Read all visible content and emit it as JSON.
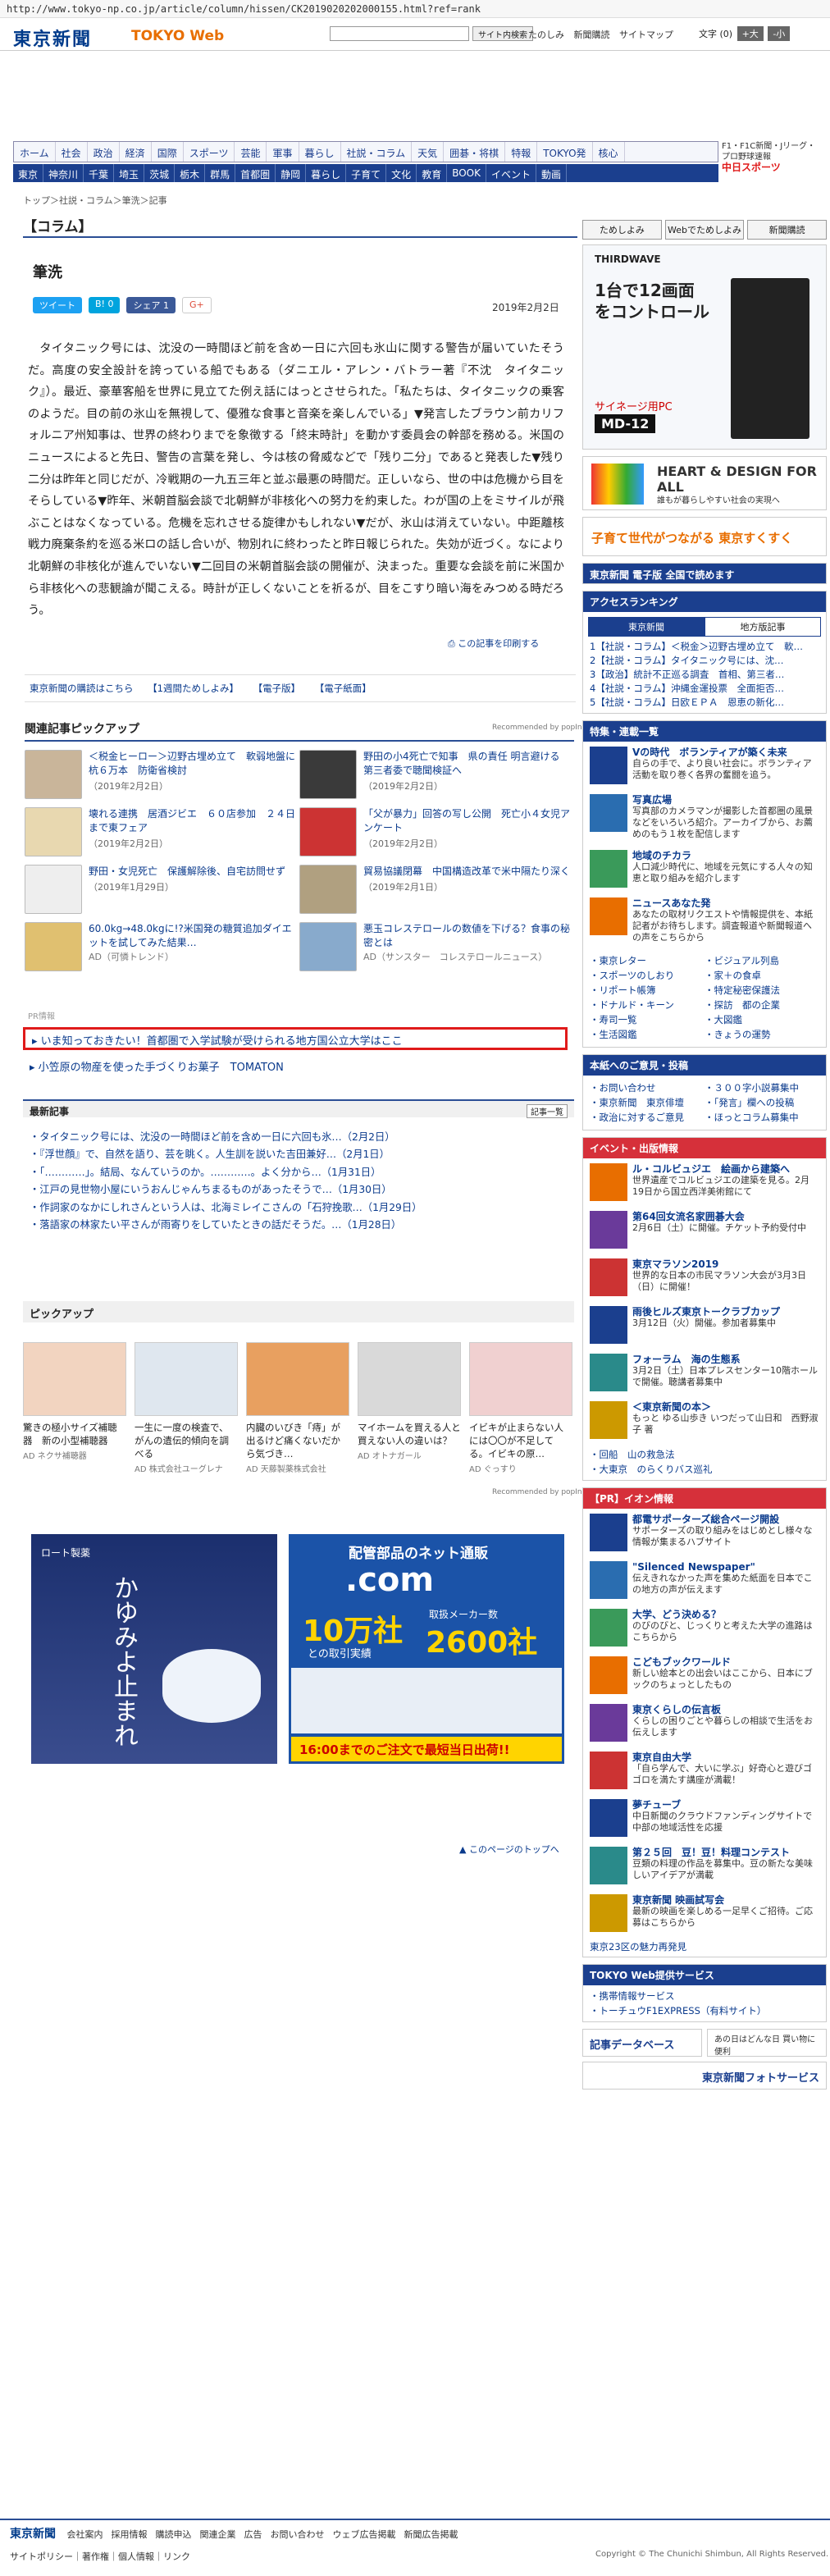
{
  "url": "http://www.tokyo-np.co.jp/article/column/hissen/CK2019020202000155.html?ref=rank",
  "brand": {
    "main": "東京新聞",
    "web": "TOKYO Web"
  },
  "topbar": {
    "search_btn": "サイト内検索",
    "links": [
      "たのしみ",
      "新聞購読",
      "サイトマップ"
    ],
    "font": "文字",
    "font_size": "(0)",
    "plus": "+大",
    "minus": "-小"
  },
  "nav1": [
    "ホーム",
    "社会",
    "政治",
    "経済",
    "国際",
    "スポーツ",
    "芸能",
    "軍事",
    "暮らし",
    "社説・コラム",
    "天気",
    "囲碁・将棋",
    "特報",
    "TOKYO発",
    "核心"
  ],
  "nav2": [
    "東京",
    "神奈川",
    "千葉",
    "埼玉",
    "茨城",
    "栃木",
    "群馬",
    "首都圏",
    "静岡",
    "暮らし",
    "子育て",
    "文化",
    "教育",
    "BOOK",
    "イベント",
    "動画"
  ],
  "chunichi": {
    "line1": "F1・F1C新聞・Jリーグ・プロ野球速報",
    "brand": "中日スポーツ"
  },
  "breadcrumb": "トップ＞社説・コラム＞筆洗＞記事",
  "column_head": "【コラム】",
  "article": {
    "title": "筆洗",
    "date": "2019年2月2日",
    "share": [
      "ツイート",
      "B! 0",
      "シェア 1",
      "G+"
    ],
    "body": "タイタニック号には、沈没の一時間ほど前を含め一日に六回も氷山に関する警告が届いていたそうだ。高度の安全設計を誇っている船でもある（ダニエル・アレン・バトラー著『不沈　タイタニック』）。最近、豪華客船を世界に見立てた例え話にはっとさせられた。「私たちは、タイタニックの乗客のようだ。目の前の氷山を無視して、優雅な食事と音楽を楽しんでいる」▼発言したブラウン前カリフォルニア州知事は、世界の終わりまでを象徴する「終末時計」を動かす委員会の幹部を務める。米国のニュースによると先日、警告の言葉を発し、今は核の脅威などで「残り二分」であると発表した▼残り二分は昨年と同じだが、冷戦期の一九五三年と並ぶ最悪の時間だ。正しいなら、世の中は危機から目をそらしている▼昨年、米朝首脳会談で北朝鮮が非核化への努力を約束した。わが国の上をミサイルが飛ぶことはなくなっている。危機を忘れさせる旋律かもしれない▼だが、氷山は消えていない。中距離核戦力廃棄条約を巡る米ロの話し合いが、物別れに終わったと昨日報じられた。失効が近づく。なにより北朝鮮の非核化が進んでいない▼二回目の米朝首脳会談の開催が、決まった。重要な会談を前に米国から非核化への悲観論が聞こえる。時計が正しくないことを祈るが、目をこすり暗い海をみつめる時だろう。",
    "print": "この記事を印刷する",
    "links": [
      "東京新聞の購読はこちら",
      "【1週間ためしよみ】",
      "【電子版】",
      "【電子紙面】"
    ]
  },
  "related": {
    "title": "関連記事ピックアップ",
    "recommended": "Recommended by popIn",
    "items": [
      {
        "text": "＜税金ヒーロー＞辺野古埋め立て　軟弱地盤に杭６万本　防衛省検討",
        "date": "（2019年2月2日）"
      },
      {
        "text": "野田の小4死亡で知事　県の責任 明言避ける　第三者委で聴聞検証へ",
        "date": "（2019年2月2日）"
      },
      {
        "text": "壊れる連携　居酒ジビエ　６０店参加　２４日まで東フェア",
        "date": "（2019年2月2日）"
      },
      {
        "text": "「父が暴力」回答の写し公開　死亡小４女児アンケート",
        "date": "（2019年2月2日）"
      },
      {
        "text": "野田・女児死亡　保護解除後、自宅訪問せず",
        "date": "（2019年1月29日）"
      },
      {
        "text": "貿易協議閉幕　中国構造改革で米中隔たり深く",
        "date": "（2019年2月1日）"
      },
      {
        "text": "60.0kg→48.0kgに!?米国発の糖質追加ダイエットを試してみた結果…",
        "ad": "AD（可憐トレンド）"
      },
      {
        "text": "悪玉コレステロールの数値を下げる？食事の秘密とは",
        "ad": "AD（サンスター　コレステロールニュース）"
      }
    ]
  },
  "pr": {
    "label": "PR情報",
    "feature": "いま知っておきたい！首都圏で入学試験が受けられる地方国公立大学はここ",
    "sub": "小笠原の物産を使った手づくりお菓子　TOMATON"
  },
  "latest": {
    "title": "最新記事",
    "more": "記事一覧",
    "items": [
      "タイタニック号には、沈没の一時間ほど前を含め一日に六回も氷…（2月2日）",
      "『浮世顔』で、自然を語り、芸を眺く。人生訓を説いた吉田兼好…（2月1日）",
      "「…………」。結局、なんていうのか。…………。よく分から…（1月31日）",
      "江戸の見世物小屋にいうおんじゃんちまるものがあったそうで…（1月30日）",
      "作詞家のなかにしれさんという人は、北海ミレイこさんの「石狩挽歌…（1月29日）",
      "落語家の林家たい平さんが雨寄りをしていたときの話だそうだ。…（1月28日）"
    ]
  },
  "pickup": {
    "title": "ピックアップ",
    "recommended": "Recommended by popIn",
    "items": [
      {
        "t": "驚きの極小サイズ補聴器　新の小型補聴器",
        "a": "AD ネクサ補聴器"
      },
      {
        "t": "一生に一度の検査で、がんの遺伝的傾向を調べる",
        "a": "AD 株式会社ユーグレナ"
      },
      {
        "t": "内臓のいびき「痔」が出るけど痛くないだから気づき…",
        "a": "AD 天藤製薬株式会社"
      },
      {
        "t": "マイホームを買える人と買えない人の違いは？",
        "a": "AD オトナガール"
      },
      {
        "t": "イビキが止まらない人には〇〇が不足してる。イビキの原…",
        "a": "AD ぐっすり"
      }
    ]
  },
  "ad1": {
    "brand": "ロート製薬",
    "copy": "かゆみよ止まれ"
  },
  "ad2": {
    "head": "配管部品のネット通販",
    "site": ".com",
    "big": "10万社",
    "big_sub": "との取引実績",
    "num": "2600社",
    "num_sub": "取扱メーカー数",
    "foot": "16:00までのご注文で最短当日出荷!!"
  },
  "to_top": "このページのトップへ",
  "side": {
    "btns": [
      "ためしよみ",
      "Webでためしよみ",
      "新聞購読"
    ],
    "ad_pc": {
      "brand": "THIRDWAVE",
      "copy": "1台で12画面をコントロール",
      "sub": "サイネージ用PC",
      "model": "MD-12"
    },
    "hd": {
      "title": "HEART & DESIGN FOR ALL",
      "sub": "誰もが暮らしやすい社会の実現へ"
    },
    "sukusuku": "子育て世代がつながる 東京すくすく",
    "denshi": "東京新聞 電子版 全国で読めます",
    "ranking": {
      "title": "アクセスランキング",
      "tabs": [
        "東京新聞",
        "地方版記事"
      ],
      "items": [
        "1【社説・コラム】＜税金＞辺野古埋め立て　軟…",
        "2【社説・コラム】タイタニック号には、沈…",
        "3【政治】統計不正巡る調査　首相、第三者…",
        "4【社説・コラム】沖縄金運投票　全面拒否…",
        "5【社説・コラム】日欧ＥＰＡ　恩恵の新化…"
      ]
    },
    "feature": {
      "title": "特集・連載一覧",
      "items": [
        {
          "t": "Vの時代　ボランティアが築く未来",
          "d": "自らの手で、より良い社会に。ボランティア活動を取り巻く各界の奮闘を追う。"
        },
        {
          "t": "写真広場",
          "d": "写真部のカメラマンが撮影した首都圏の風景などをいろいろ紹介。アーカイブから、お薦めのもう１枚を配信します"
        },
        {
          "t": "地域のチカラ",
          "d": "人口減少時代に、地域を元気にする人々の知恵と取り組みを紹介します"
        },
        {
          "t": "ニュースあなた発",
          "d": "あなたの取材リクエストや情報提供を、本紙記者がお待ちします。調査報道や新聞報道への声をこちらから"
        }
      ],
      "links": [
        "東京レター",
        "ビジュアル列島",
        "スポーツのしおり",
        "家＋の食卓",
        "リポート帳簿",
        "特定秘密保護法",
        "ドナルド・キーン",
        "探訪　都の企業",
        "寿司一覧",
        "大図鑑",
        "生活図鑑",
        "きょうの運勢"
      ]
    },
    "opinion": {
      "title": "本紙へのご意見・投稿",
      "items": [
        "お問い合わせ",
        "３００字小説募集中",
        "東京新聞　東京俳壇",
        "「発言」欄への投稿",
        "政治に対するご意見",
        "ほっとコラム募集中"
      ]
    },
    "events": {
      "title": "イベント・出版情報",
      "items": [
        {
          "t": "ル・コルビュジエ　絵画から建築へ",
          "d": "世界遺産でコルビュジエの建築を見る。2月19日から国立西洋美術館にて"
        },
        {
          "t": "第64回女流名家囲碁大会",
          "d": "2月6日（土）に開催。チケット予約受付中"
        },
        {
          "t": "東京マラソン2019",
          "d": "世界的な日本の市民マラソン大会が3月3日（日）に開催！"
        },
        {
          "t": "雨後ヒルズ東京トークラブカップ",
          "d": "3月12日（火）開催。参加者募集中"
        },
        {
          "t": "フォーラム　海の生態系",
          "d": "3月2日（土）日本プレスセンター10階ホールで開催。聴講者募集中"
        },
        {
          "t": "＜東京新聞の本＞",
          "d": "もっと ゆる山歩き いつだって山日和　西野淑子 著"
        }
      ],
      "links": [
        "回船　山の救急法",
        "大東京　のらくりバス巡礼"
      ]
    },
    "aeon": {
      "title": "【PR】イオン情報",
      "items": [
        {
          "t": "都電サポーターズ総合ページ開設",
          "d": "サポーターズの取り組みをはじめとし様々な情報が集まるハブサイト"
        },
        {
          "t": "\"Silenced Newspaper\"",
          "d": "伝えきれなかった声を集めた紙面を日本でこの地方の声が伝えます"
        },
        {
          "t": "大学、どう決める？",
          "d": "のびのびと、じっくりと考えた大学の進路はこちらから"
        },
        {
          "t": "こどもブックワールド",
          "d": "新しい絵本との出会いはここから、日本にブックのちょっとしたもの"
        },
        {
          "t": "東京くらしの伝言板",
          "d": "くらしの困りごとや暮らしの相談で生活をお伝えします"
        },
        {
          "t": "東京自由大学",
          "d": "「自ら学んで、大いに学ぶ」好奇心と遊びゴゴロを満たす講座が満載！"
        },
        {
          "t": "夢チューブ",
          "d": "中日新聞のクラウドファンディングサイトで中部の地域活性を応援"
        },
        {
          "t": "第２５回　豆！豆！料理コンテスト",
          "d": "豆類の料理の作品を募集中。豆の新たな美味しいアイデアが満載"
        },
        {
          "t": "東京新聞 映画試写会",
          "d": "最新の映画を楽しめる一足早くご招待。ご応募はこちらから"
        }
      ],
      "more": "東京23区の魅力再発見"
    },
    "service": {
      "title": "TOKYO Web提供サービス",
      "items": [
        "携帯情報サービス",
        "トーチュウF1EXPRESS（有料サイト）"
      ]
    },
    "db": "記事データベース",
    "aruhi": "あの日はどんな日 買い物に便利",
    "photo": "東京新聞フォトサービス"
  },
  "footer": {
    "logo": "東京新聞",
    "links": [
      "会社案内",
      "採用情報",
      "購読申込",
      "関連企業",
      "広告",
      "お問い合わせ",
      "ウェブ広告掲載",
      "新聞広告掲載"
    ],
    "links2": "サイトポリシー｜著作権｜個人情報｜リンク",
    "copyright": "Copyright © The Chunichi Shimbun, All Rights Reserved."
  },
  "colors": {
    "navy": "#1b3f8e",
    "red": "#d6303a"
  }
}
